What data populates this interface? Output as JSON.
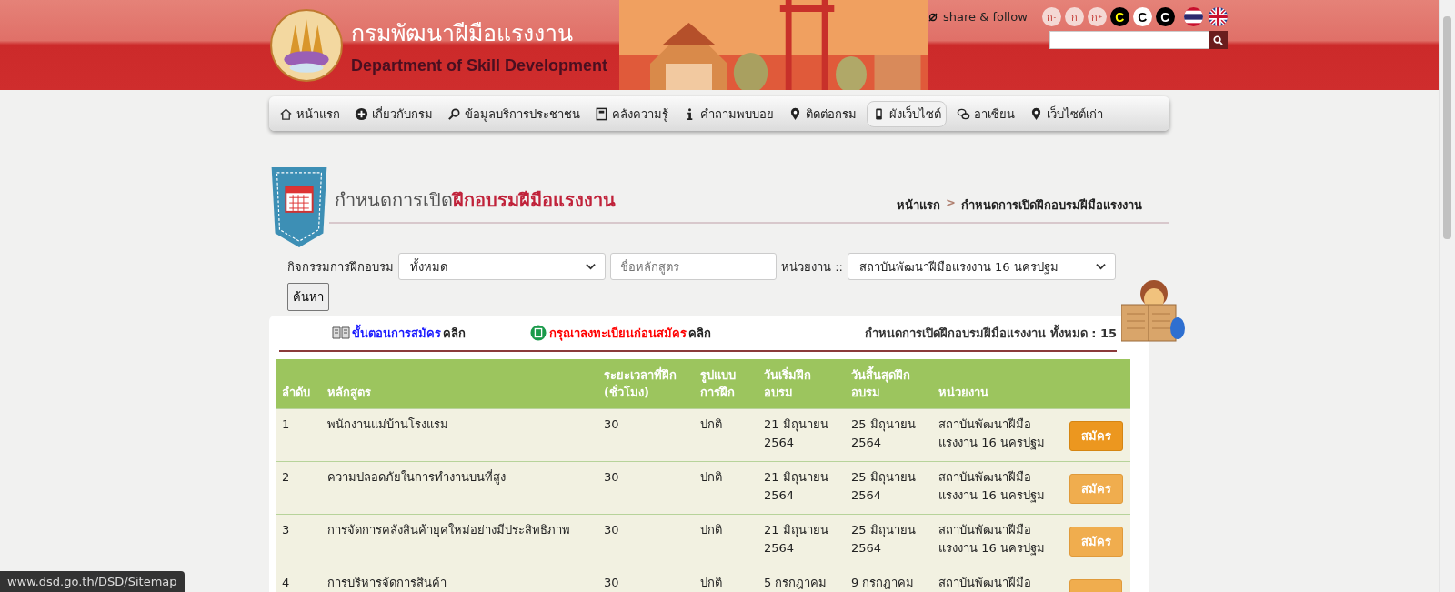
{
  "header": {
    "title_th": "กรมพัฒนาฝีมือแรงงาน",
    "title_en": "Department of Skill Development",
    "share_label": "share & follow",
    "font_buttons": [
      {
        "label": "ก",
        "sup": "-"
      },
      {
        "label": "ก"
      },
      {
        "label": "ก",
        "sup": "+"
      }
    ],
    "contrast_buttons": [
      {
        "label": "C",
        "kind": "yellow"
      },
      {
        "label": "C",
        "kind": "white"
      },
      {
        "label": "C",
        "kind": "black"
      }
    ]
  },
  "nav": {
    "items": [
      {
        "label": "หน้าแรก",
        "selected": false
      },
      {
        "label": "เกี่ยวกับกรม",
        "selected": false
      },
      {
        "label": "ข้อมูลบริการประชาชน",
        "selected": false
      },
      {
        "label": "คลังความรู้",
        "selected": false
      },
      {
        "label": "คำถามพบบ่อย",
        "selected": false
      },
      {
        "label": "ติดต่อกรม",
        "selected": false
      },
      {
        "label": "ผังเว็บไซต์",
        "selected": true
      },
      {
        "label": "อาเซียน",
        "selected": false
      },
      {
        "label": "เว็บไซต์เก่า",
        "selected": false
      }
    ]
  },
  "page_title": {
    "lead": "กำหนดการเปิด",
    "highlight": "ฝึกอบรมฝีมือแรงงาน"
  },
  "breadcrumb": {
    "items": [
      "หน้าแรก",
      "กำหนดการเปิดฝึกอบรมฝีมือแรงงาน"
    ],
    "separator": ">"
  },
  "filters": {
    "activity_label": "กิจกรรมการฝึกอบรม",
    "activity_value": "ทั้งหมด",
    "course_placeholder": "ชื่อหลักสูตร",
    "unit_label": "หน่วยงาน ::",
    "unit_value": "สถาบันพัฒนาฝีมือแรงงาน 16 นครปฐม",
    "search_button": "ค้นหา"
  },
  "card": {
    "links": [
      {
        "text": "ขั้นตอนการสมัคร",
        "suffix": "คลิก",
        "kind": "steps",
        "color": "#1a1aff"
      },
      {
        "text": "กรุณาลงทะเบียนก่อนสมัคร",
        "suffix": "คลิก",
        "kind": "register",
        "color": "#ff0000"
      }
    ],
    "total": "กำหนดการเปิดฝึกอบรมฝีมือแรงงาน ทั้งหมด : 15"
  },
  "table": {
    "columns": [
      "ลำดับ",
      "หลักสูตร",
      "ระยะเวลาที่ฝึก\n(ชั่วโมง)",
      "รูปแบบ\nการฝึก",
      "วันเริ่มฝึก\nอบรม",
      "วันสิ้นสุดฝึก\nอบรม",
      "หน่วยงาน"
    ],
    "rows": [
      {
        "no": "1",
        "course": "พนักงานแม่บ้านโรงแรม",
        "hours": "30",
        "mode": "ปกติ",
        "start": "21 มิถุนายน\n2564",
        "end": "25 มิถุนายน\n2564",
        "unit": "สถาบันพัฒนาฝีมือ\nแรงงาน 16 นครปฐม",
        "apply_label": "สมัคร",
        "highlighted": true
      },
      {
        "no": "2",
        "course": "ความปลอดภัยในการทำงานบนที่สูง",
        "hours": "30",
        "mode": "ปกติ",
        "start": "21 มิถุนายน\n2564",
        "end": "25 มิถุนายน\n2564",
        "unit": "สถาบันพัฒนาฝีมือ\nแรงงาน 16 นครปฐม",
        "apply_label": "สมัคร",
        "highlighted": false
      },
      {
        "no": "3",
        "course": "การจัดการคลังสินค้ายุคใหม่อย่างมีประสิทธิภาพ",
        "hours": "30",
        "mode": "ปกติ",
        "start": "21 มิถุนายน\n2564",
        "end": "25 มิถุนายน\n2564",
        "unit": "สถาบันพัฒนาฝีมือ\nแรงงาน 16 นครปฐม",
        "apply_label": "สมัคร",
        "highlighted": false
      },
      {
        "no": "4",
        "course": "การบริหารจัดการสินค้า",
        "hours": "30",
        "mode": "ปกติ",
        "start": "5 กรกฎาคม",
        "end": "9 กรกฎาคม",
        "unit": "สถาบันพัฒนาฝีมือ"
      }
    ]
  },
  "status_url": "www.dsd.go.th/DSD/Sitemap"
}
